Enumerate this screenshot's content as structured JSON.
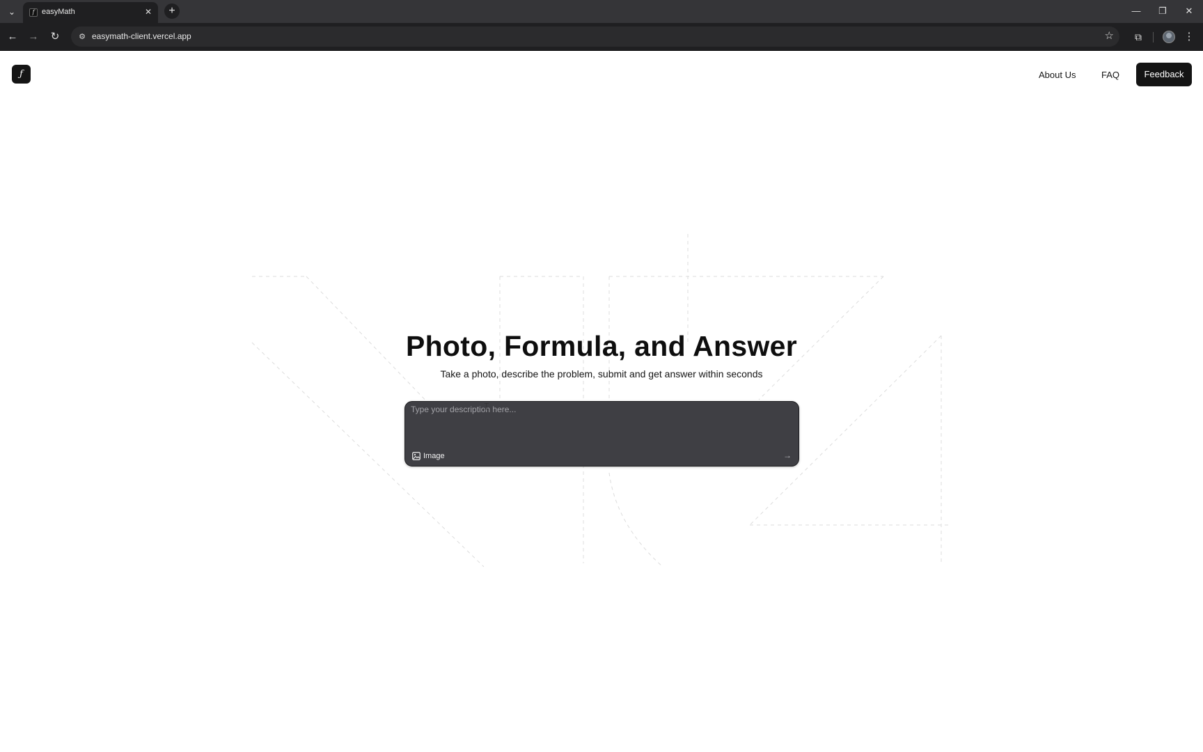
{
  "browser": {
    "tab_title": "easyMath",
    "url": "easymath-client.vercel.app",
    "icons": [
      "tab-search-icon",
      "close-icon",
      "plus-icon",
      "minimize-icon",
      "restore-icon",
      "close-window-icon",
      "back-icon",
      "forward-icon",
      "reload-icon",
      "site-info-icon",
      "star-icon",
      "extensions-icon",
      "profile-avatar",
      "more-menu-icon"
    ]
  },
  "header": {
    "logo_glyph": "ƒ",
    "nav": {
      "about": "About Us",
      "faq": "FAQ",
      "feedback": "Feedback"
    }
  },
  "hero": {
    "title": "Photo, Formula, and Answer",
    "subtitle": "Take a photo, describe the problem, submit and get answer within seconds"
  },
  "composer": {
    "placeholder": "Type your description here...",
    "value": "",
    "image_label": "Image",
    "send_icon": "arrow-right-icon"
  },
  "colors": {
    "page_bg": "#ffffff",
    "primary_button": "#141414",
    "composer_bg": "#3f3f44",
    "browser_frame": "#353538"
  }
}
